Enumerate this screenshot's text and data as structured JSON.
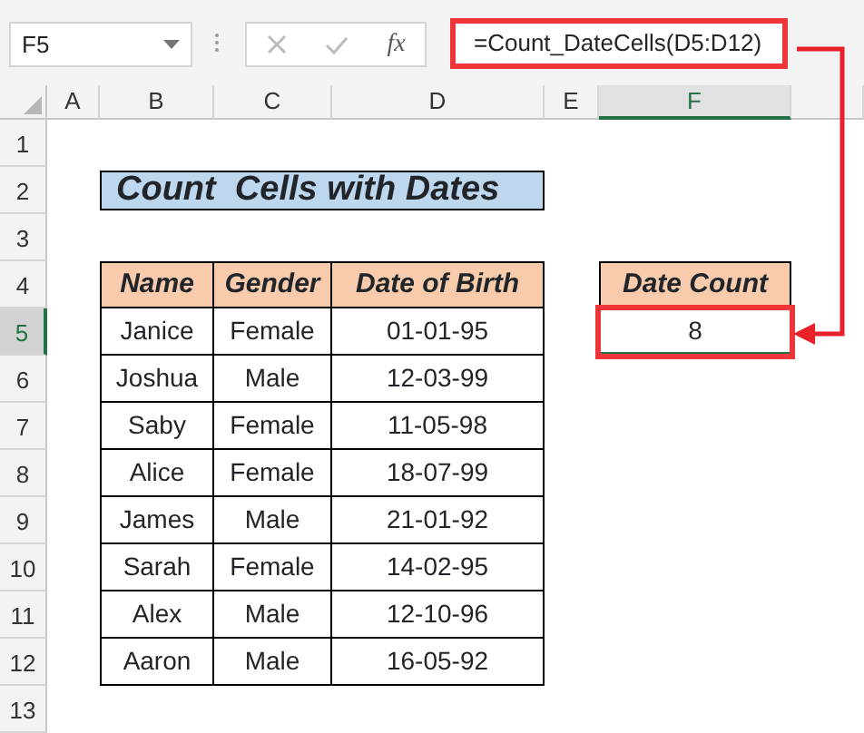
{
  "name_box": {
    "value": "F5"
  },
  "formula_bar": {
    "function_label": "fx",
    "formula": "=Count_DateCells(D5:D12)",
    "highlighted": true
  },
  "columns": [
    {
      "label": "A",
      "selected": false
    },
    {
      "label": "B",
      "selected": false
    },
    {
      "label": "C",
      "selected": false
    },
    {
      "label": "D",
      "selected": false
    },
    {
      "label": "E",
      "selected": false
    },
    {
      "label": "F",
      "selected": true
    }
  ],
  "row_numbers": [
    {
      "label": "1",
      "selected": false
    },
    {
      "label": "2",
      "selected": false
    },
    {
      "label": "3",
      "selected": false
    },
    {
      "label": "4",
      "selected": false
    },
    {
      "label": "5",
      "selected": true
    },
    {
      "label": "6",
      "selected": false
    },
    {
      "label": "7",
      "selected": false
    },
    {
      "label": "8",
      "selected": false
    },
    {
      "label": "9",
      "selected": false
    },
    {
      "label": "10",
      "selected": false
    },
    {
      "label": "11",
      "selected": false
    },
    {
      "label": "12",
      "selected": false
    },
    {
      "label": "13",
      "selected": false
    }
  ],
  "title": "Count  Cells with Dates",
  "table": {
    "columns": [
      "Name",
      "Gender",
      "Date of Birth"
    ],
    "rows": [
      [
        "Janice",
        "Female",
        "01-01-95"
      ],
      [
        "Joshua",
        "Male",
        "12-03-99"
      ],
      [
        "Saby",
        "Female",
        "11-05-98"
      ],
      [
        "Alice",
        "Female",
        "18-07-99"
      ],
      [
        "James",
        "Male",
        "21-01-92"
      ],
      [
        "Sarah",
        "Female",
        "14-02-95"
      ],
      [
        "Alex",
        "Male",
        "12-10-96"
      ],
      [
        "Aaron",
        "Male",
        "16-05-92"
      ]
    ]
  },
  "result": {
    "header": "Date Count",
    "value": "8",
    "selected": true,
    "highlighted": true
  }
}
